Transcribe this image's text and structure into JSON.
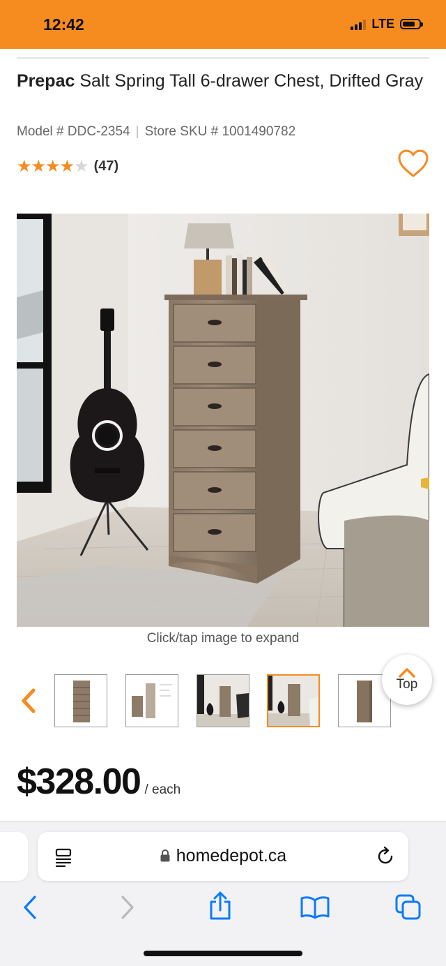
{
  "status_bar": {
    "time": "12:42",
    "network": "LTE"
  },
  "product": {
    "brand": "Prepac",
    "name": "Salt Spring Tall 6-drawer Chest, Drifted Gray",
    "model": "Model # DDC-2354",
    "separator": "|",
    "sku": "Store SKU # 1001490782",
    "rating": 4,
    "review_count": "(47)"
  },
  "gallery": {
    "caption": "Click/tap image to expand",
    "top_label": "Top",
    "thumbnail_count": 5,
    "active_thumbnail": 4
  },
  "price": {
    "amount": "$328.00",
    "unit": "/ each"
  },
  "browser": {
    "url": "homedepot.ca"
  },
  "colors": {
    "accent": "#f68b1f",
    "ios_blue": "#0a7aff"
  }
}
